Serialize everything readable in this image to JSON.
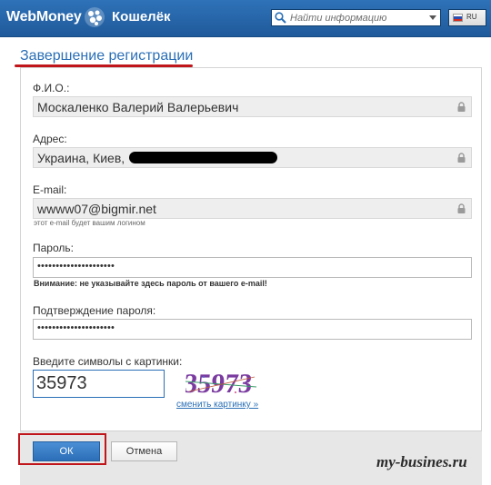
{
  "header": {
    "logo": "WebMoney",
    "product": "Кошелёк",
    "search_placeholder": "Найти информацию",
    "language": "RU"
  },
  "page": {
    "title": "Завершение регистрации"
  },
  "form": {
    "fio_label": "Ф.И.О.:",
    "fio_value": "Москаленко Валерий Валерьевич",
    "address_label": "Адрес:",
    "address_value": "Украина, Киев,",
    "email_label": "E-mail:",
    "email_value": "wwww07@bigmir.net",
    "email_hint": "этот e-mail будет вашим логином",
    "password_label": "Пароль:",
    "password_mask": "•••••••••••••••••••••",
    "password_warning": "Внимание: не указывайте здесь пароль от вашего e-mail!",
    "confirm_label": "Подтверждение пароля:",
    "confirm_mask": "•••••••••••••••••••••",
    "captcha_label": "Введите символы с картинки:",
    "captcha_value": "35973",
    "captcha_image_text": "35973",
    "captcha_refresh": "сменить картинку »"
  },
  "actions": {
    "ok": "ОК",
    "cancel": "Отмена"
  },
  "watermark": "my-busines.ru",
  "colors": {
    "header_blue": "#2a6ab0",
    "accent_red": "#c0161b",
    "link_blue": "#2a6fb6"
  }
}
